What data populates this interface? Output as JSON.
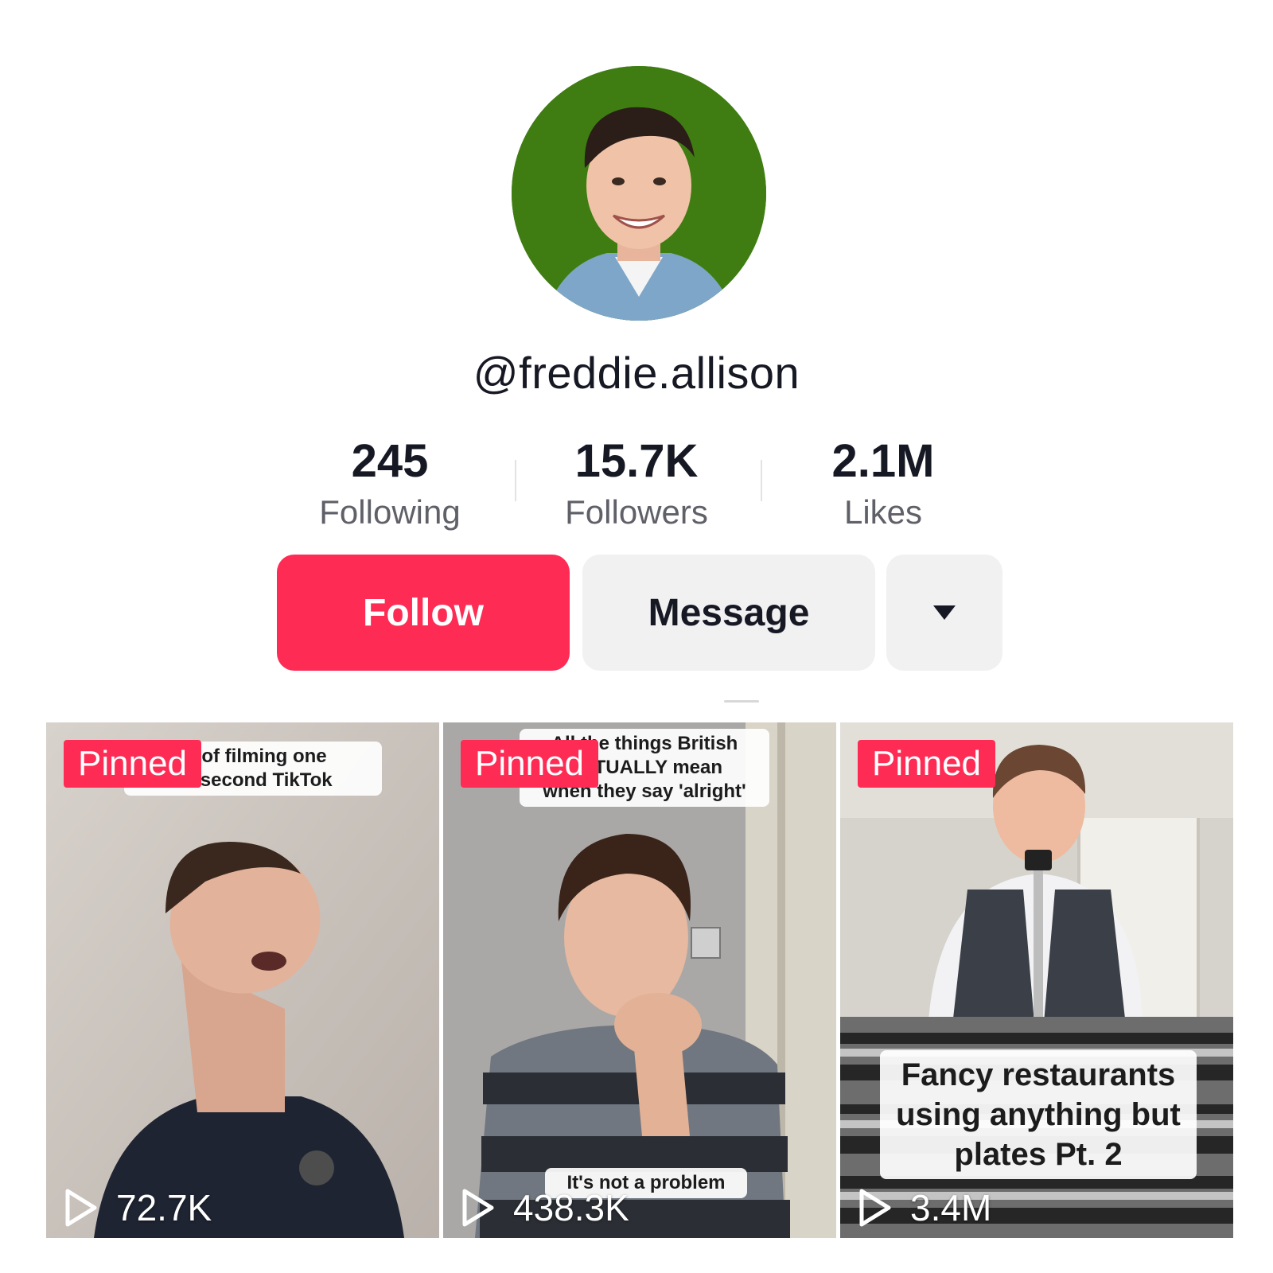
{
  "profile": {
    "username": "@freddie.allison",
    "avatar_icon": "profile-photo"
  },
  "stats": [
    {
      "value": "245",
      "label": "Following"
    },
    {
      "value": "15.7K",
      "label": "Followers"
    },
    {
      "value": "2.1M",
      "label": "Likes"
    }
  ],
  "actions": {
    "follow_label": "Follow",
    "message_label": "Message",
    "more_icon": "caret-down-icon"
  },
  "colors": {
    "accent": "#fe2c55",
    "button_gray": "#f1f1f2",
    "text_primary": "#161823",
    "text_secondary": "#5f6068",
    "avatar_bg": "#3f7d12"
  },
  "videos": [
    {
      "badge": "Pinned",
      "caption_top": [
        "ty of filming one",
        "15 second TikTok"
      ],
      "caption_big": [],
      "caption_bottom": "",
      "views": "72.7K",
      "play_icon": "play-icon"
    },
    {
      "badge": "Pinned",
      "caption_top": [
        "All the things British",
        "ACTUALLY mean",
        "when they say 'alright'"
      ],
      "caption_big": [],
      "caption_bottom": "It's not a problem",
      "views": "438.3K",
      "play_icon": "play-icon"
    },
    {
      "badge": "Pinned",
      "caption_top": [],
      "caption_big": [
        "Fancy restaurants",
        "using anything but",
        "plates Pt. 2"
      ],
      "caption_bottom": "",
      "views": "3.4M",
      "play_icon": "play-icon"
    }
  ]
}
